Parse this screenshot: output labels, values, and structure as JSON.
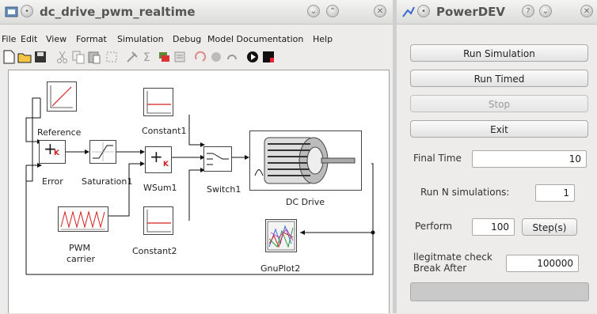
{
  "main_window": {
    "title": "dc_drive_pwm_realtime",
    "menu": [
      "File",
      "Edit",
      "View",
      "Format",
      "Simulation",
      "Debug",
      "Model Documentation",
      "Help"
    ],
    "toolbar_icons": [
      "new-file-icon",
      "open-folder-icon",
      "save-icon",
      "cut-icon",
      "copy-icon",
      "paste-icon",
      "select-icon",
      "tools-icon",
      "sum-icon",
      "layers-icon",
      "properties-icon",
      "rotate-icon",
      "record-icon",
      "refresh-icon",
      "play-icon",
      "stop-icon"
    ],
    "blocks": {
      "reference": "Reference",
      "error": "Error",
      "saturation": "Saturation1",
      "wsum": "WSum1",
      "constant1": "Constant1",
      "switch": "Switch1",
      "dc_drive": "DC Drive",
      "pwm_line1": "PWM",
      "pwm_line2": "carrier",
      "constant2": "Constant2",
      "gnuplot": "GnuPlot2"
    },
    "gain_mark": "K",
    "sum_mark": "+"
  },
  "sim_window": {
    "title": "PowerDEV",
    "buttons": {
      "run_simulation": "Run Simulation",
      "run_timed": "Run Timed",
      "stop": "Stop",
      "exit": "Exit",
      "step": "Step(s)"
    },
    "final_time_label": "Final Time",
    "final_time_value": "10",
    "run_n_label": "Run N simulations:",
    "run_n_value": "1",
    "perform_label": "Perform",
    "perform_value": "100",
    "illegitimate_label_1": "llegitmate check",
    "illegitimate_label_2": "Break After",
    "illegitimate_value": "100000"
  },
  "colors": {
    "accent_red": "#d42020",
    "wire": "#1a1a1a"
  }
}
